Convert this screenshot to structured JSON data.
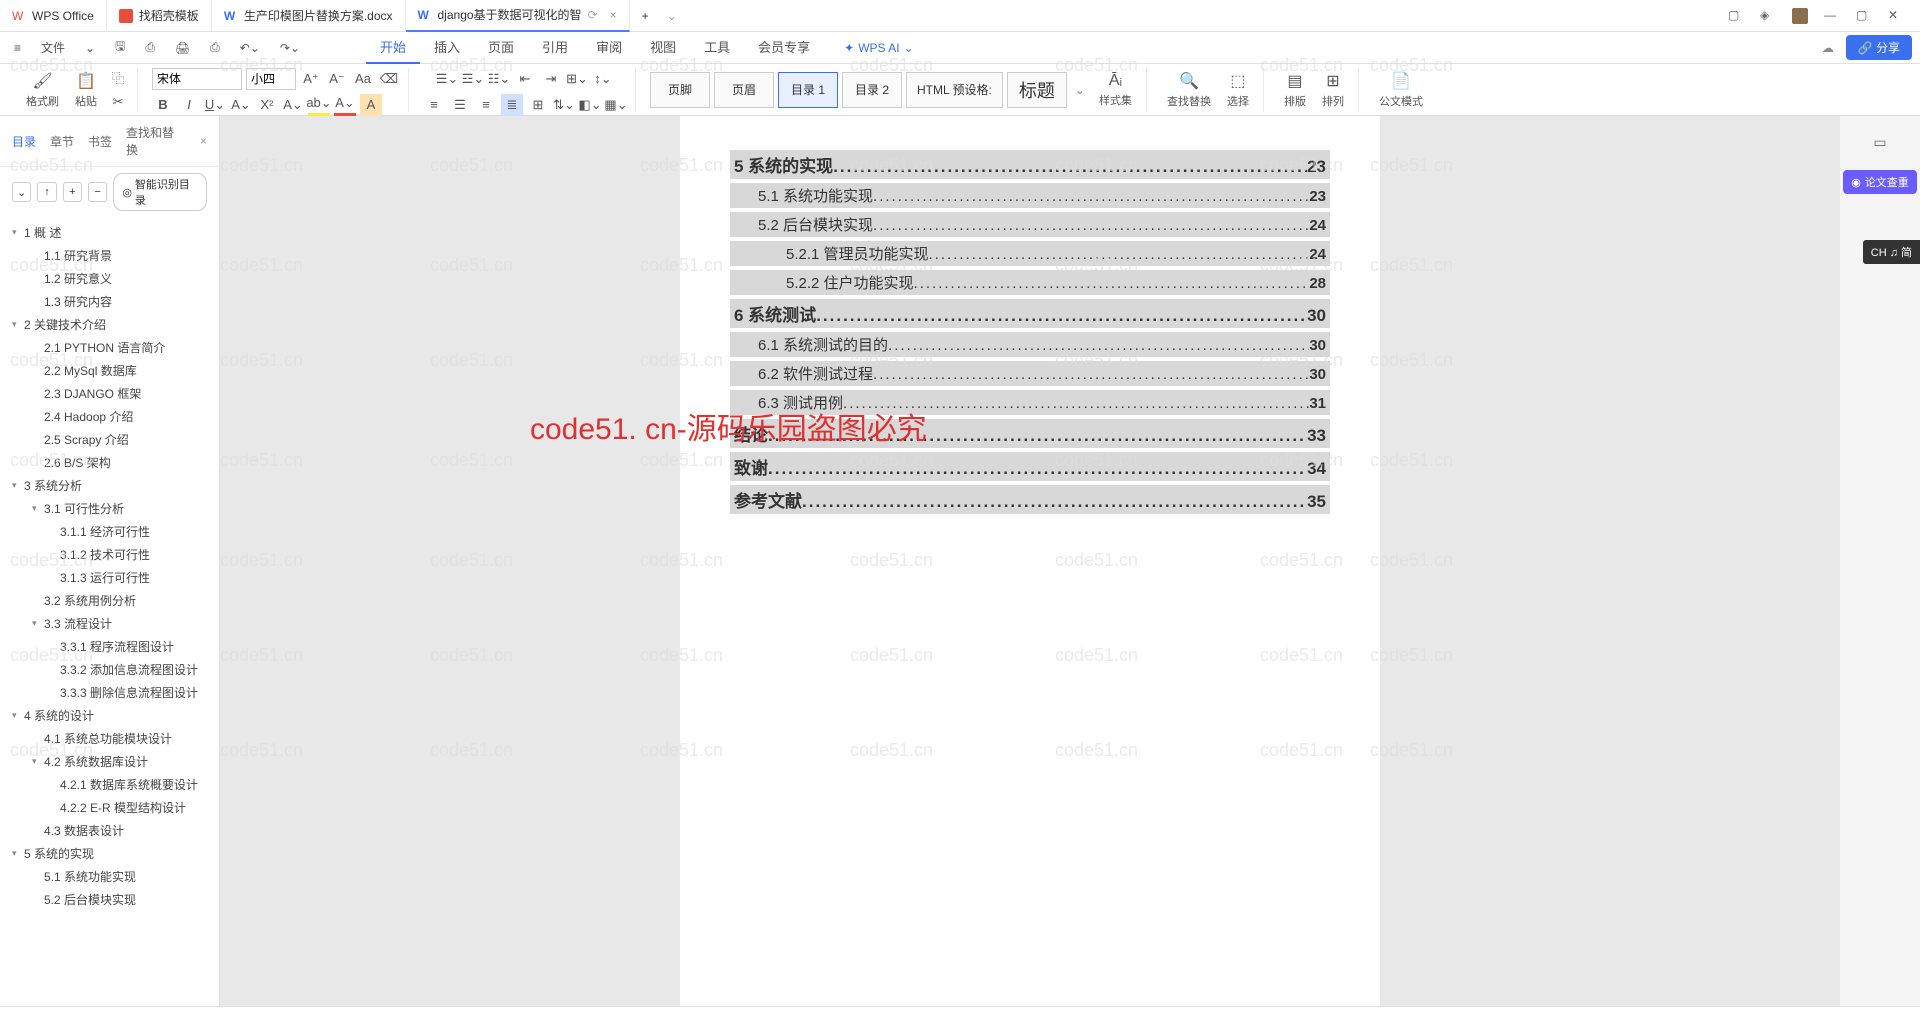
{
  "app": {
    "name": "WPS Office"
  },
  "tabs": [
    {
      "label": "找稻壳模板",
      "iconColor": "#e74c3c"
    },
    {
      "label": "生产印模图片替换方案.docx",
      "iconColor": "#3a6fef"
    },
    {
      "label": "django基于数据可视化的智",
      "iconColor": "#3a6fef",
      "active": true
    }
  ],
  "fileMenu": "文件",
  "menus": [
    "开始",
    "插入",
    "页面",
    "引用",
    "审阅",
    "视图",
    "工具",
    "会员专享"
  ],
  "activeMenu": "开始",
  "wpsAi": "WPS AI",
  "share": "分享",
  "toolbar": {
    "formatBrush": "格式刷",
    "paste": "粘贴",
    "font": "宋体",
    "fontSize": "小四",
    "styleGallery": [
      "页脚",
      "页眉",
      "目录 1",
      "目录 2",
      "HTML 预设格:",
      "标题"
    ],
    "activeStyle": "目录 1",
    "styleSet": "样式集",
    "findReplace": "查找替换",
    "select": "选择",
    "layout": "排版",
    "arrange": "排列",
    "officialMode": "公文模式"
  },
  "sidebar": {
    "tabs": [
      "目录",
      "章节",
      "书签",
      "查找和替换"
    ],
    "activeTab": "目录",
    "smartToc": "智能识别目录",
    "outline": [
      {
        "level": 1,
        "text": "1  概    述",
        "toggle": true
      },
      {
        "level": 2,
        "text": "1.1 研究背景"
      },
      {
        "level": 2,
        "text": "1.2 研究意义"
      },
      {
        "level": 2,
        "text": "1.3 研究内容"
      },
      {
        "level": 1,
        "text": "2  关键技术介绍",
        "toggle": true
      },
      {
        "level": 2,
        "text": "2.1 PYTHON 语言简介"
      },
      {
        "level": 2,
        "text": "2.2 MySql 数据库"
      },
      {
        "level": 2,
        "text": "2.3 DJANGO 框架"
      },
      {
        "level": 2,
        "text": "2.4 Hadoop 介绍"
      },
      {
        "level": 2,
        "text": "2.5 Scrapy 介绍"
      },
      {
        "level": 2,
        "text": "2.6 B/S 架构"
      },
      {
        "level": 1,
        "text": "3  系统分析",
        "toggle": true
      },
      {
        "level": 2,
        "text": "3.1 可行性分析",
        "toggle": true
      },
      {
        "level": 3,
        "text": "3.1.1 经济可行性"
      },
      {
        "level": 3,
        "text": "3.1.2 技术可行性"
      },
      {
        "level": 3,
        "text": "3.1.3 运行可行性"
      },
      {
        "level": 2,
        "text": "3.2 系统用例分析"
      },
      {
        "level": 2,
        "text": "3.3 流程设计",
        "toggle": true
      },
      {
        "level": 3,
        "text": "3.3.1 程序流程图设计"
      },
      {
        "level": 3,
        "text": "3.3.2 添加信息流程图设计"
      },
      {
        "level": 3,
        "text": "3.3.3 删除信息流程图设计"
      },
      {
        "level": 1,
        "text": "4  系统的设计",
        "toggle": true
      },
      {
        "level": 2,
        "text": "4.1 系统总功能模块设计"
      },
      {
        "level": 2,
        "text": "4.2 系统数据库设计",
        "toggle": true
      },
      {
        "level": 3,
        "text": "4.2.1 数据库系统概要设计"
      },
      {
        "level": 3,
        "text": "4.2.2 E-R 模型结构设计"
      },
      {
        "level": 2,
        "text": "4.3 数据表设计"
      },
      {
        "level": 1,
        "text": "5  系统的实现",
        "toggle": true
      },
      {
        "level": 2,
        "text": "5.1 系统功能实现"
      },
      {
        "level": 2,
        "text": "5.2 后台模块实现"
      }
    ]
  },
  "document": {
    "toc": [
      {
        "level": 1,
        "title": "5  系统的实现",
        "page": "23"
      },
      {
        "level": 2,
        "title": "5.1 系统功能实现",
        "page": "23"
      },
      {
        "level": 2,
        "title": "5.2 后台模块实现",
        "page": "24"
      },
      {
        "level": 3,
        "title": "5.2.1 管理员功能实现",
        "page": "24"
      },
      {
        "level": 3,
        "title": "5.2.2 住户功能实现",
        "page": "28"
      },
      {
        "level": 1,
        "title": "6 系统测试",
        "page": "30"
      },
      {
        "level": 2,
        "title": "6.1 系统测试的目的",
        "page": "30"
      },
      {
        "level": 2,
        "title": "6.2 软件测试过程",
        "page": "30"
      },
      {
        "level": 2,
        "title": "6.3 测试用例",
        "page": "31"
      },
      {
        "level": 1,
        "title": "结论",
        "page": "33"
      },
      {
        "level": 1,
        "title": "致谢",
        "page": "34"
      },
      {
        "level": 1,
        "title": "参考文献",
        "page": "35"
      }
    ]
  },
  "rightPanel": {
    "paperCheck": "论文查重"
  },
  "watermarkText": "code51.cn",
  "redWatermark": "code51. cn-源码乐园盗图必究",
  "ime": "CH ♫ 简"
}
